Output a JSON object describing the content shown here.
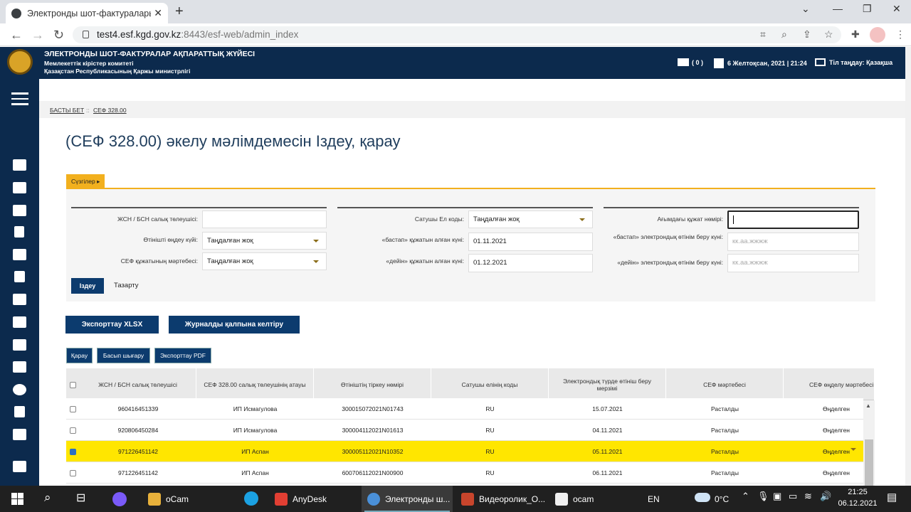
{
  "browser": {
    "tab_title": "Электронды шот-фактураларын",
    "url_host": "test4.esf.kgd.gov.kz",
    "url_rest": ":8443/esf-web/admin_index"
  },
  "header": {
    "line1": "ЭЛЕКТРОНДЫ ШОТ-ФАКТУРАЛАР АҚПАРАТТЫҚ ЖҮЙЕСІ",
    "line2": "Мемлекеттік кірістер комитеті",
    "line3": "Қазақстан Республикасының Қаржы министрлігі",
    "mail_count": "( 0 )",
    "datetime": "6 Желтоқсан, 2021 | 21:24",
    "language": "Тіл таңдау: Қазақша"
  },
  "breadcrumb": {
    "home": "БАСТЫ БЕТ",
    "sep": "::",
    "current": "СЕФ 328.00"
  },
  "page_title": "(СЕФ 328.00) әкелу мәлімдемесін Іздеу, қарау",
  "filters": {
    "tab_label": "Сүзгілер",
    "col1": [
      {
        "label": "ЖСН / БСН салық төлеушісі:",
        "value": ""
      },
      {
        "label": "Өтінішті өңдеу күйі:",
        "value": "Таңдалған жоқ"
      },
      {
        "label": "СЕФ құжатының мәртебесі:",
        "value": "Таңдалған жоқ"
      }
    ],
    "col2": [
      {
        "label": "Сатушы Ел коды:",
        "value": "Таңдалған жоқ"
      },
      {
        "label": "«бастап» құжатын алған күні:",
        "value": "01.11.2021"
      },
      {
        "label": "«дейін» құжатын алған күні:",
        "value": "01.12.2021"
      }
    ],
    "col3": [
      {
        "label": "Ағымдағы құжат нөмірі:",
        "value": ""
      },
      {
        "label": "«бастап» электрондық өтінім беру күні:",
        "placeholder": "кк.аа.жжжж"
      },
      {
        "label": "«дейін» электрондық өтінім беру күні:",
        "placeholder": "кк.аа.жжжж"
      }
    ],
    "search_button": "Іздеу",
    "clear_button": "Тазарту"
  },
  "actions": {
    "export_xlsx": "Экспорттау XLSX",
    "restore_journal": "Журналды қалпына келтіру",
    "view": "Қарау",
    "print": "Басып шығару",
    "export_pdf": "Экспорттау PDF"
  },
  "table": {
    "columns": [
      "ЖСН / БСН салық төлеушісі",
      "СЕФ 328.00 салық төлеушінің атауы",
      "Өтініштің тіркеу нөмірі",
      "Сатушы елінің коды",
      "Электрондық түрде өтініш беру мерзімі",
      "СЕФ мәртебесі",
      "СЕФ өңделу мәртебесі"
    ],
    "rows": [
      {
        "checked": false,
        "cells": [
          "960416451339",
          "ИП Исмагулова",
          "300015072021N01743",
          "RU",
          "15.07.2021",
          "Расталды",
          "Өңделген"
        ]
      },
      {
        "checked": false,
        "cells": [
          "920806450284",
          "ИП Исмагулова",
          "300004112021N01613",
          "RU",
          "04.11.2021",
          "Расталды",
          "Өңделген"
        ]
      },
      {
        "checked": true,
        "cells": [
          "971226451142",
          "ИП Аспан",
          "300005112021N10352",
          "RU",
          "05.11.2021",
          "Расталды",
          "Өңделген"
        ]
      },
      {
        "checked": false,
        "cells": [
          "971226451142",
          "ИП Аспан",
          "600706112021N00900",
          "RU",
          "06.11.2021",
          "Расталды",
          "Өңделген"
        ]
      }
    ]
  },
  "taskbar": {
    "items": [
      "oCam",
      "AnyDesk",
      "Электронды ш...",
      "Видеоролик_О...",
      "ocam"
    ],
    "lang": "EN",
    "temp": "0°C",
    "time": "21:25",
    "date": "06.12.2021"
  }
}
